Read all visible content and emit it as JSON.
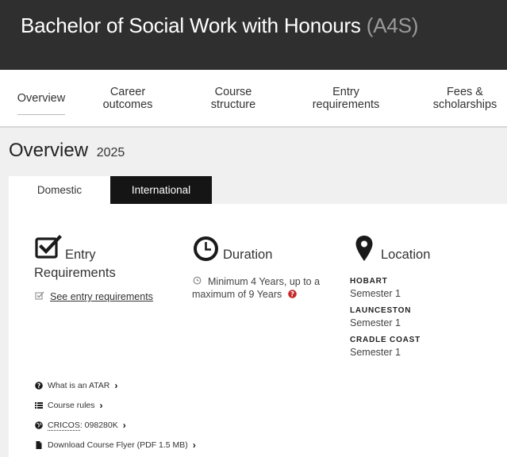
{
  "header": {
    "title": "Bachelor of Social Work with Honours",
    "code": "(A4S)"
  },
  "nav": [
    {
      "label": "Overview"
    },
    {
      "label": "Career outcomes"
    },
    {
      "label": "Course structure"
    },
    {
      "label": "Entry requirements"
    },
    {
      "label": "Fees & scholarships"
    }
  ],
  "page": {
    "title": "Overview",
    "year": "2025"
  },
  "tabs": {
    "domestic": "Domestic",
    "international": "International"
  },
  "entry": {
    "heading_line1": "Entry",
    "heading_line2": "Requirements",
    "link": "See entry requirements"
  },
  "duration": {
    "heading": "Duration",
    "text_line1": "Minimum 4 Years, up to a",
    "text_line2": "maximum of 9 Years"
  },
  "location": {
    "heading": "Location",
    "campuses": [
      {
        "name": "HOBART",
        "semester": "Semester 1"
      },
      {
        "name": "LAUNCESTON",
        "semester": "Semester 1"
      },
      {
        "name": "CRADLE COAST",
        "semester": "Semester 1"
      }
    ]
  },
  "links": {
    "atar": "What is an ATAR",
    "rules": "Course rules",
    "cricos_label": "CRICOS",
    "cricos_code": ": 098280K",
    "flyer": "Download Course Flyer (PDF 1.5 MB)"
  },
  "colors": {
    "header_bg": "#2f2f2f",
    "tab_active_bg": "#151515",
    "help_icon": "#c62828"
  }
}
